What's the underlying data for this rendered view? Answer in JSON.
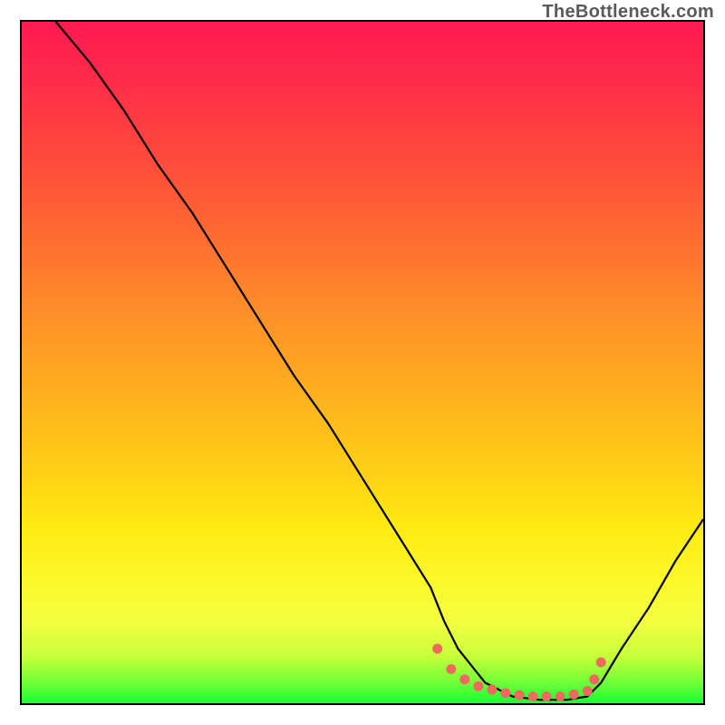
{
  "watermark": "TheBottleneck.com",
  "chart_data": {
    "type": "line",
    "title": "",
    "xlabel": "",
    "ylabel": "",
    "xlim": [
      0,
      100
    ],
    "ylim": [
      0,
      100
    ],
    "grid": false,
    "curve": {
      "name": "bottleneck-curve",
      "color": "#000000",
      "x": [
        5,
        10,
        15,
        20,
        25,
        30,
        35,
        40,
        45,
        50,
        55,
        60,
        62,
        64,
        68,
        72,
        76,
        80,
        83,
        85,
        88,
        92,
        96,
        100
      ],
      "y": [
        100,
        94,
        87,
        79,
        72,
        64,
        56,
        48,
        41,
        33,
        25,
        17,
        12,
        8,
        3,
        1,
        0.5,
        0.5,
        1,
        3,
        8,
        14,
        21,
        27
      ]
    },
    "minimum_markers": {
      "name": "minimum-band",
      "color": "#ee6a5e",
      "x": [
        61,
        63,
        65,
        67,
        69,
        71,
        73,
        75,
        77,
        79,
        81,
        83,
        84,
        85
      ],
      "y": [
        8,
        5,
        3.5,
        2.5,
        2,
        1.5,
        1.2,
        1,
        1,
        1,
        1.3,
        1.8,
        3.5,
        6
      ]
    },
    "gradient_stops": [
      {
        "pos": 0,
        "color": "#ff1a52"
      },
      {
        "pos": 16,
        "color": "#ff4040"
      },
      {
        "pos": 36,
        "color": "#ff7a2e"
      },
      {
        "pos": 56,
        "color": "#ffb41e"
      },
      {
        "pos": 74,
        "color": "#ffea12"
      },
      {
        "pos": 88,
        "color": "#f4fe40"
      },
      {
        "pos": 97,
        "color": "#70ff38"
      },
      {
        "pos": 100,
        "color": "#18ff34"
      }
    ]
  }
}
